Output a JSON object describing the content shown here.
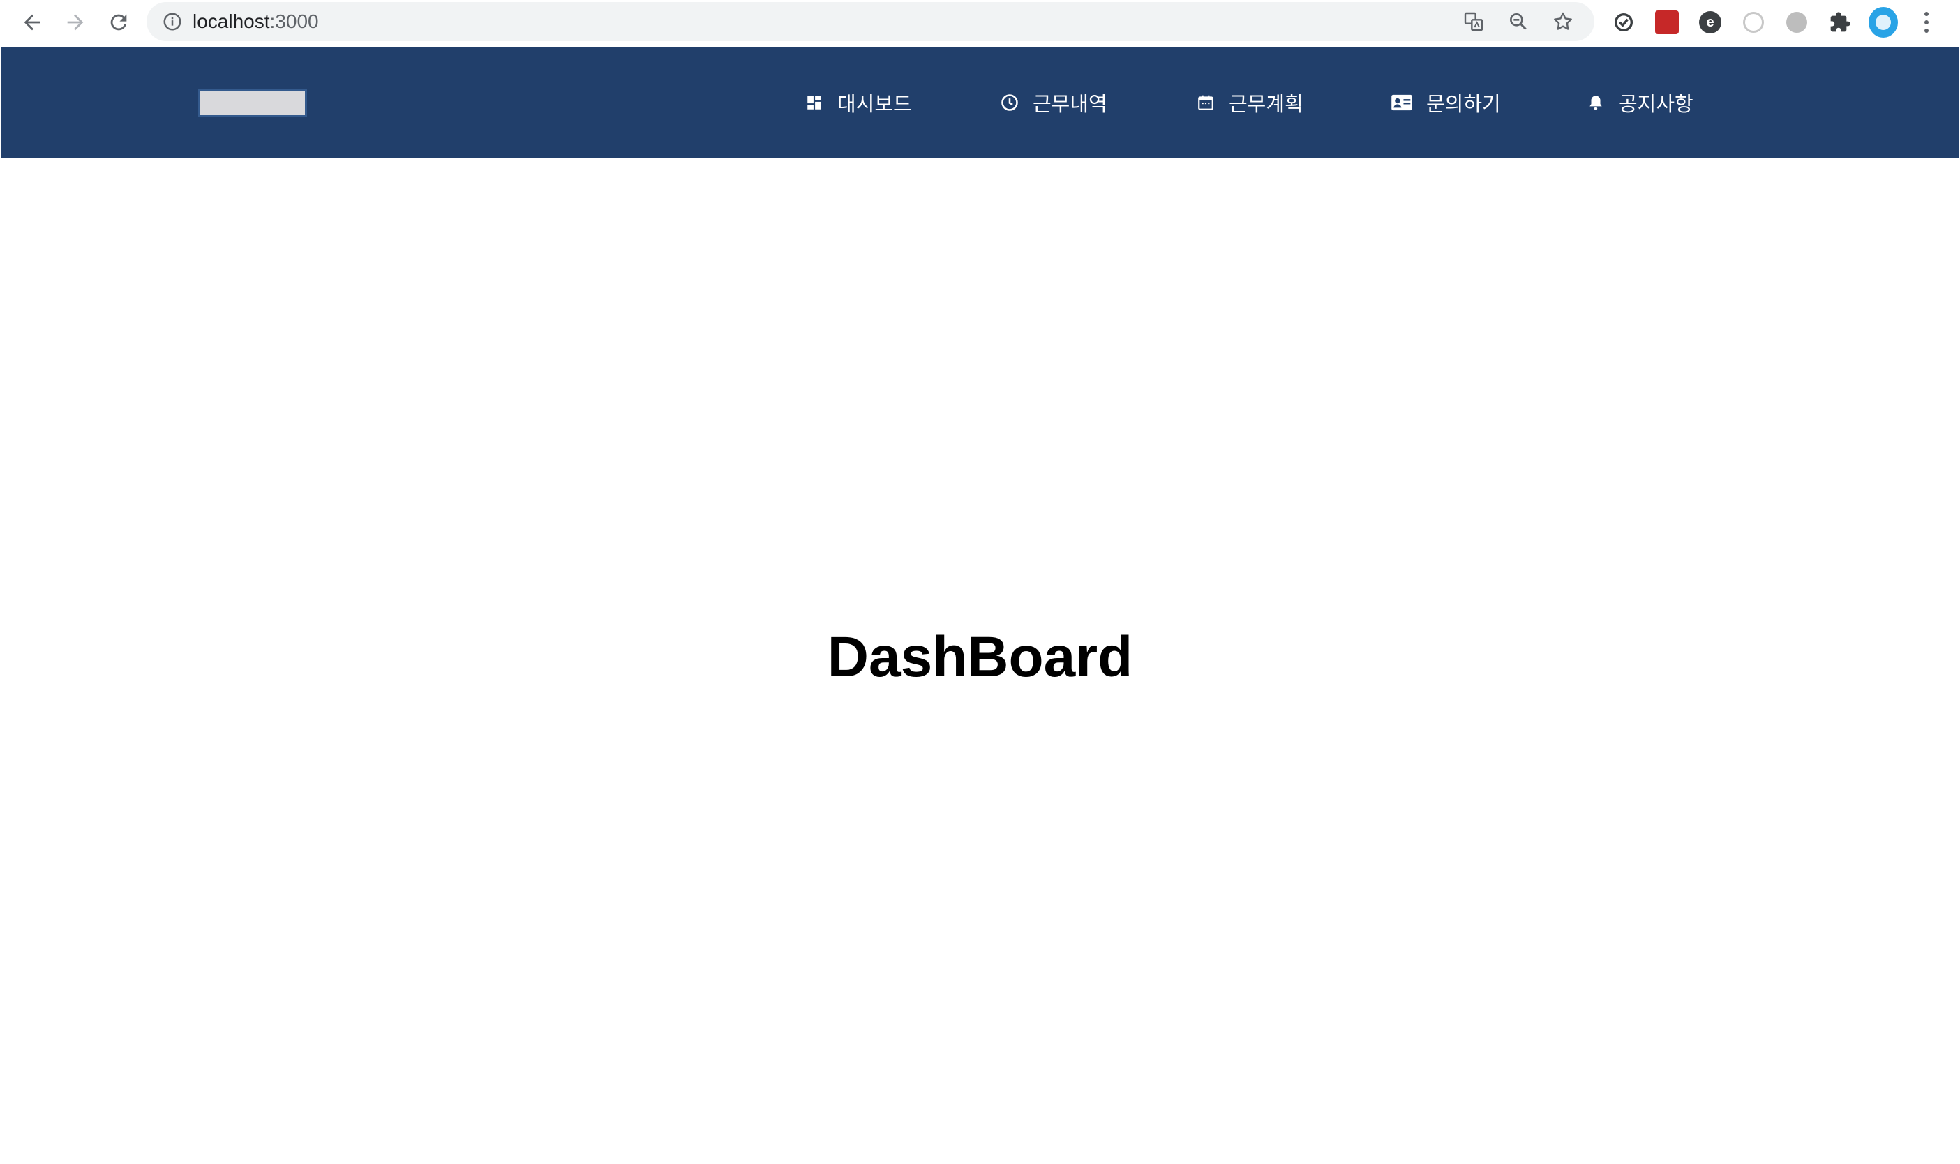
{
  "browser": {
    "url_host": "localhost",
    "url_port": ":3000"
  },
  "header": {
    "menu": [
      {
        "label": "대시보드",
        "icon": "dashboard-icon"
      },
      {
        "label": "근무내역",
        "icon": "clock-icon"
      },
      {
        "label": "근무계획",
        "icon": "calendar-icon"
      },
      {
        "label": "문의하기",
        "icon": "contact-card-icon"
      },
      {
        "label": "공지사항",
        "icon": "bell-icon"
      }
    ],
    "background": "#213f6b"
  },
  "main": {
    "title": "DashBoard"
  }
}
